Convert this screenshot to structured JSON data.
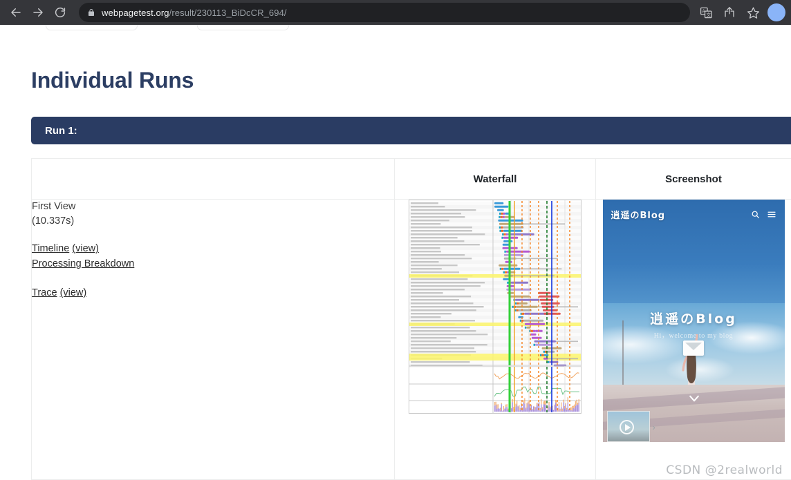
{
  "browser": {
    "back_icon": "back-arrow-icon",
    "forward_icon": "forward-arrow-icon",
    "reload_icon": "reload-icon",
    "lock_icon": "lock-icon",
    "url_host": "webpagetest.org",
    "url_path": "/result/230113_BiDcCR_694/",
    "translate_icon": "translate-icon",
    "share_icon": "share-icon",
    "bookmark_icon": "star-icon",
    "profile_avatar": "profile-avatar"
  },
  "page": {
    "heading": "Individual Runs",
    "run_header": "Run 1:"
  },
  "table": {
    "headers": [
      "",
      "Waterfall",
      "Screenshot"
    ],
    "row": {
      "view_name": "First View",
      "view_time": "(10.337s)",
      "timeline_label": "Timeline",
      "timeline_view": "(view)",
      "processing_breakdown_label": "Processing Breakdown",
      "trace_label": "Trace",
      "trace_view": "(view)"
    }
  },
  "waterfall": {
    "alt": "request waterfall chart",
    "colors": {
      "dns": "#1aa3c8",
      "connect": "#f26c22",
      "ssl": "#b45ad1",
      "html": "#3a9ad9",
      "js": "#c0a878",
      "css": "#8f78c9",
      "image": "#b79bdc",
      "other": "#b0b0b0",
      "start_render": "#34d13a",
      "dom_content_loaded": "#f0a020",
      "on_load": "#1133dd",
      "first_paint": "#1d7a2b",
      "marker_dashed": "#f58220",
      "highlight_row": "#fbf46a"
    }
  },
  "screenshot": {
    "site_logo": "逍遥のBlog",
    "search_icon": "search-icon",
    "menu_icon": "hamburger-menu-icon",
    "hero_title": "逍遥のBlog",
    "hero_subtitle": "Hi，welcome to my blog",
    "mail_icon": "envelope-icon",
    "scroll_icon": "chevron-down-icon",
    "video_play_icon": "play-button-icon",
    "video_next_icon": "chevron-right-icon"
  },
  "watermark": "CSDN @2realworld"
}
